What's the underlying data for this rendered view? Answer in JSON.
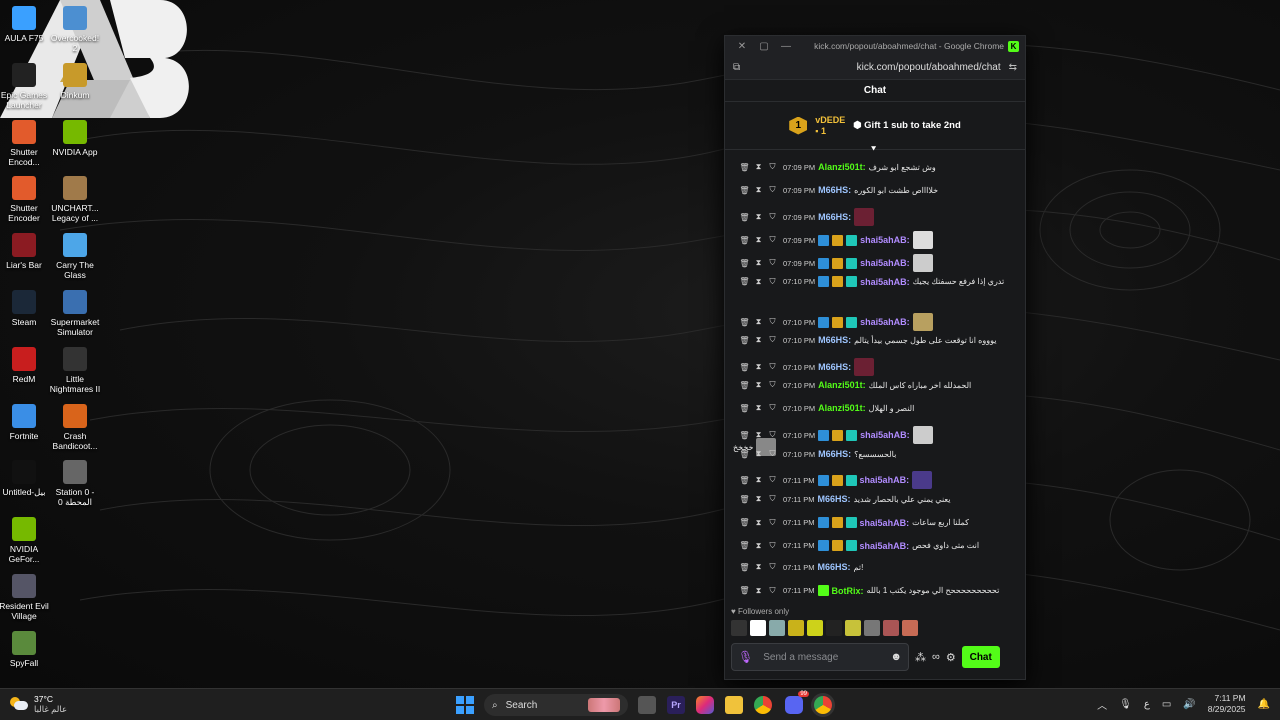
{
  "desktop": {
    "icons_left": [
      {
        "label": "AULA F75",
        "color": "#3aa0ff",
        "icon": "keyboard-icon"
      },
      {
        "label": "Epic Games Launcher",
        "color": "#222",
        "icon": "epic-icon"
      },
      {
        "label": "Shutter Encod...",
        "color": "#e25b2c",
        "icon": "shutter-icon"
      },
      {
        "label": "Shutter Encoder",
        "color": "#e25b2c",
        "icon": "shutter-icon"
      },
      {
        "label": "Liar's Bar",
        "color": "#8b1b22",
        "icon": "liars-bar-icon"
      },
      {
        "label": "Steam",
        "color": "#1b2838",
        "icon": "steam-icon"
      },
      {
        "label": "RedM",
        "color": "#c81e1e",
        "icon": "redm-icon"
      },
      {
        "label": "Fortnite",
        "color": "#3a8ee6",
        "icon": "fortnite-icon"
      },
      {
        "label": "Untitled-بيل",
        "color": "#111",
        "icon": "file-icon"
      },
      {
        "label": "NVIDIA GeFor...",
        "color": "#76b900",
        "icon": "nvidia-icon"
      },
      {
        "label": "Resident Evil Village",
        "color": "#556",
        "icon": "re-village-icon"
      },
      {
        "label": "SpyFall",
        "color": "#5a8a3c",
        "icon": "spyfall-icon"
      }
    ],
    "icons_right": [
      {
        "label": "Overcooked! 2",
        "color": "#4c8fd1",
        "icon": "overcooked-icon"
      },
      {
        "label": "Dinkum",
        "color": "#c89a2a",
        "icon": "dinkum-icon"
      },
      {
        "label": "NVIDIA App",
        "color": "#76b900",
        "icon": "nvidia-icon"
      },
      {
        "label": "UNCHART... Legacy of ...",
        "color": "#a07a4a",
        "icon": "uncharted-icon"
      },
      {
        "label": "Carry The Glass",
        "color": "#4da6e8",
        "icon": "carry-glass-icon"
      },
      {
        "label": "Supermarket Simulator",
        "color": "#3a6fb0",
        "icon": "supermarket-icon"
      },
      {
        "label": "Little Nightmares II",
        "color": "#333",
        "icon": "little-nightmares-icon"
      },
      {
        "label": "Crash Bandicoot...",
        "color": "#d9641b",
        "icon": "crash-icon"
      },
      {
        "label": "Station 0 - المحطة 0",
        "color": "#666",
        "icon": "station-icon"
      }
    ]
  },
  "window": {
    "title": "kick.com/popout/aboahmed/chat - Google Chrome",
    "url": "kick.com/popout/aboahmed/chat",
    "controls": {
      "close": "✕",
      "restore": "▢",
      "minimize": "—"
    }
  },
  "chat": {
    "header": "Chat",
    "pinned": {
      "rank": "1",
      "user": "vDEDE",
      "count": "1",
      "gift_text": "Gift 1 sub to take 2nd"
    },
    "messages": [
      {
        "time": "07:09 PM",
        "user": "Alanzi501t:",
        "ucolor": "#53fc18",
        "text": "وش تشجع ابو شرف",
        "badges": 0,
        "emote": ""
      },
      {
        "time": "07:09 PM",
        "user": "M66HS:",
        "ucolor": "#9ec5ff",
        "text": "خلااااص طشت ابو الكوره",
        "badges": 0,
        "emote": ""
      },
      {
        "time": "07:09 PM",
        "user": "M66HS:",
        "ucolor": "#9ec5ff",
        "text": "",
        "badges": 0,
        "emote": "#6b2033"
      },
      {
        "time": "07:09 PM",
        "user": "shai5ahAB:",
        "ucolor": "#b18cff",
        "text": "",
        "badges": 3,
        "emote": "#ddd"
      },
      {
        "time": "07:09 PM",
        "user": "shai5ahAB:",
        "ucolor": "#b18cff",
        "text": "",
        "badges": 3,
        "emote": "#ccc"
      },
      {
        "time": "07:10 PM",
        "user": "shai5ahAB:",
        "ucolor": "#b18cff",
        "text": "تدري إذا فرفع حسفتك يجيك",
        "badges": 3,
        "emote": ""
      },
      {
        "time": "07:10 PM",
        "user": "shai5ahAB:",
        "ucolor": "#b18cff",
        "text": "",
        "badges": 3,
        "emote": "#b8a060"
      },
      {
        "time": "07:10 PM",
        "user": "M66HS:",
        "ucolor": "#9ec5ff",
        "text": "يوووه انا توقعت على طول جسمي بيدأ يتالم",
        "badges": 0,
        "emote": ""
      },
      {
        "time": "07:10 PM",
        "user": "M66HS:",
        "ucolor": "#9ec5ff",
        "text": "",
        "badges": 0,
        "emote": "#6b2033"
      },
      {
        "time": "07:10 PM",
        "user": "Alanzi501t:",
        "ucolor": "#53fc18",
        "text": "الحمدلله اخر مباراه كاس الملك",
        "badges": 0,
        "emote": ""
      },
      {
        "time": "07:10 PM",
        "user": "Alanzi501t:",
        "ucolor": "#53fc18",
        "text": "النصر و الهلال",
        "badges": 0,
        "emote": ""
      },
      {
        "time": "07:10 PM",
        "user": "shai5ahAB:",
        "ucolor": "#b18cff",
        "text": "",
        "badges": 3,
        "emote": "#ccc"
      },
      {
        "time": "07:10 PM",
        "user": "M66HS:",
        "ucolor": "#9ec5ff",
        "text": "بالحسسسع؟",
        "badges": 0,
        "emote": ""
      },
      {
        "time": "07:11 PM",
        "user": "shai5ahAB:",
        "ucolor": "#b18cff",
        "text": "",
        "badges": 3,
        "emote": "#4a3a8a"
      },
      {
        "time": "07:11 PM",
        "user": "M66HS:",
        "ucolor": "#9ec5ff",
        "text": "يعني يمني علي بالحصار شديد",
        "badges": 0,
        "emote": ""
      },
      {
        "time": "07:11 PM",
        "user": "shai5ahAB:",
        "ucolor": "#b18cff",
        "text": "كملنا اربع ساعات",
        "badges": 3,
        "emote": ""
      },
      {
        "time": "07:11 PM",
        "user": "shai5ahAB:",
        "ucolor": "#b18cff",
        "text": "انت متى داوي فحص",
        "badges": 3,
        "emote": ""
      },
      {
        "time": "07:11 PM",
        "user": "M66HS:",
        "ucolor": "#9ec5ff",
        "text": "!تم",
        "badges": 0,
        "emote": ""
      },
      {
        "time": "07:11 PM",
        "user": "BotRix:",
        "ucolor": "#53fc18",
        "text": "تحححححححححح الي موجود يكتب 1 بالله",
        "badges": 1,
        "emote": ""
      }
    ],
    "wrap_text": "خخخخ",
    "followers_only": "Followers only",
    "input_placeholder": "Send a message",
    "chat_button": "Chat"
  },
  "taskbar": {
    "weather_temp": "37°C",
    "weather_desc": "عالم غالبا",
    "search_label": "Search",
    "lang": "ع",
    "time": "7:11 PM",
    "date": "8/29/2025",
    "discord_badge": "99"
  }
}
